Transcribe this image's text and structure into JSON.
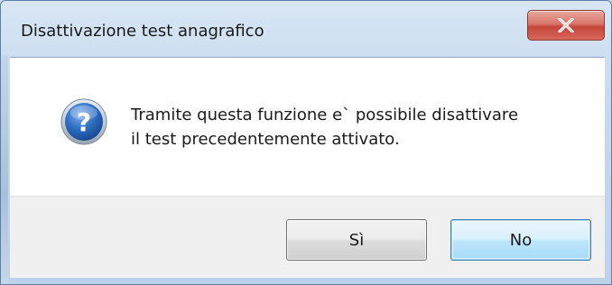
{
  "dialog": {
    "title": "Disattivazione test anagrafico",
    "close_icon": "close-icon",
    "icon": "question-icon",
    "message_line1": "Tramite questa funzione e` possibile disattivare",
    "message_line2": "il test precedentemente attivato.",
    "buttons": {
      "yes_label": "Sì",
      "no_label": "No"
    },
    "colors": {
      "close_button": "#c4463a",
      "icon_blue": "#2f6fc4",
      "default_button_border": "#3c7fb1"
    }
  }
}
